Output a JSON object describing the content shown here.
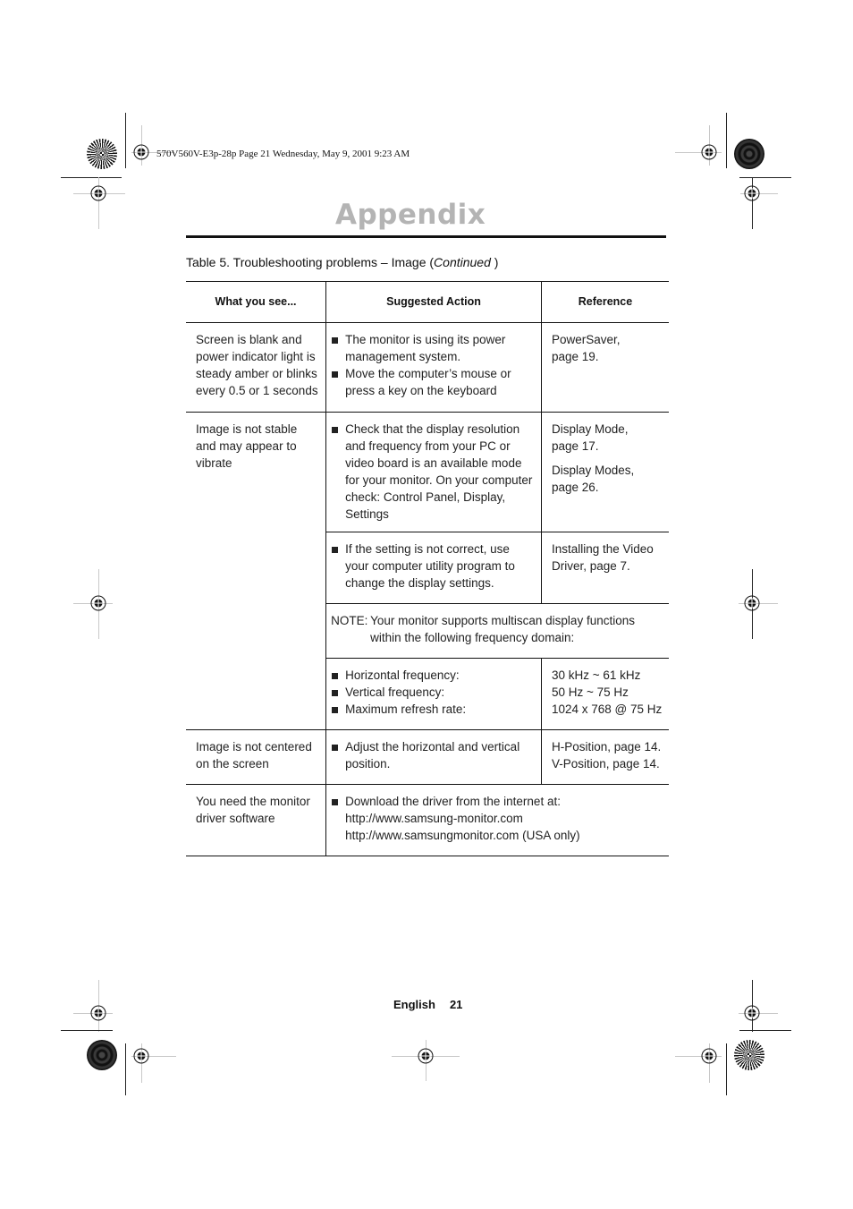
{
  "print_slug": "570V560V-E3p-28p  Page 21  Wednesday, May 9, 2001  9:23 AM",
  "section_heading": "Appendix",
  "table_caption": {
    "prefix": "Table 5.  Troubleshooting problems – Image (",
    "italic": "Continued",
    "suffix": " )"
  },
  "table": {
    "headers": [
      "What you see...",
      "Suggested Action",
      "Reference"
    ],
    "rows": [
      {
        "symptom": "Screen is blank and power indicator light is steady amber or blinks every 0.5 or 1 seconds",
        "actions": [
          "The monitor is using its power management system.",
          "Move the computer’s mouse or press a key on the keyboard"
        ],
        "references": [
          "PowerSaver, page 19."
        ]
      },
      {
        "symptom": "Image is not stable and may appear to vibrate",
        "sub_rows": [
          {
            "actions": [
              "Check that the display resolution and frequency from your PC or video board is an available mode for your monitor. On your computer check: Control Panel, Display, Settings"
            ],
            "references": [
              "Display Mode, page 17.",
              "Display Modes, page 26."
            ]
          },
          {
            "actions": [
              "If the setting is not correct, use your computer utility program to change the display settings."
            ],
            "references": [
              "Installing the Video Driver, page 7."
            ]
          }
        ],
        "note": {
          "label": "NOTE:",
          "line1": "Your monitor supports multiscan display functions",
          "line2": "within the following frequency domain:"
        },
        "specs": [
          {
            "label": "Horizontal frequency:",
            "value": "30 kHz ~ 61 kHz"
          },
          {
            "label": "Vertical frequency:",
            "value": "50 Hz ~ 75 Hz"
          },
          {
            "label": "Maximum refresh rate:",
            "value": "1024 x 768 @ 75 Hz"
          }
        ]
      },
      {
        "symptom": "Image is not centered on the screen",
        "actions": [
          "Adjust the horizontal and vertical position."
        ],
        "references": [
          "H-Position, page 14.",
          "V-Position, page 14."
        ]
      },
      {
        "symptom": "You need the monitor driver software",
        "action": "Download the driver from the internet at:",
        "links": [
          "http://www.samsung-monitor.com",
          "http://www.samsungmonitor.com (USA only)"
        ]
      }
    ]
  },
  "footer": {
    "language": "English",
    "page_number": "21"
  }
}
